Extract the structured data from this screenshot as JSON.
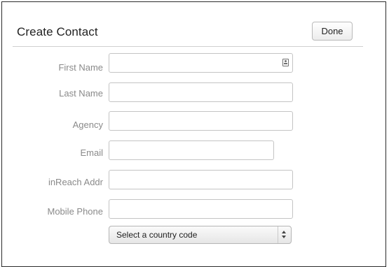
{
  "dialog": {
    "title": "Create Contact",
    "done_label": "Done"
  },
  "form": {
    "first_name": {
      "label": "First Name",
      "value": ""
    },
    "last_name": {
      "label": "Last Name",
      "value": ""
    },
    "agency": {
      "label": "Agency",
      "value": ""
    },
    "email": {
      "label": "Email",
      "value": ""
    },
    "inreach_addr": {
      "label": "inReach Addr",
      "value": ""
    },
    "mobile_phone": {
      "label": "Mobile Phone",
      "value": ""
    },
    "country_code": {
      "selected": "Select a country code"
    }
  },
  "icons": {
    "first_name_field": "contact-card-icon",
    "country_select": "up-down-arrows-icon"
  }
}
